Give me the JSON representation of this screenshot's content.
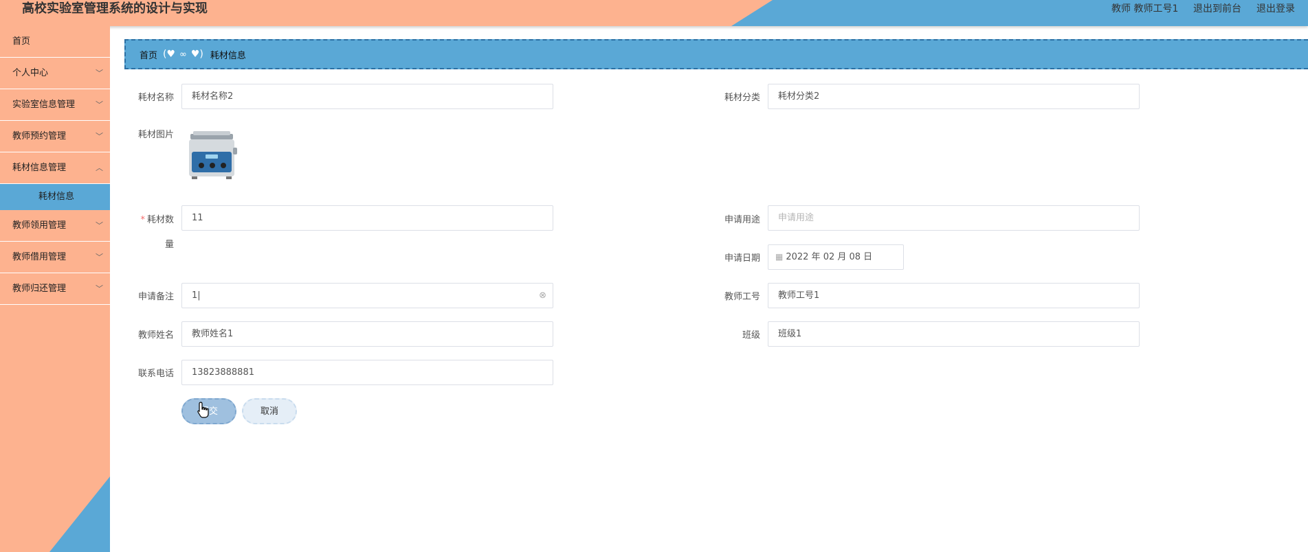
{
  "header": {
    "title": "高校实验室管理系统的设计与实现",
    "user_label": "教师  教师工号1",
    "to_front": "退出到前台",
    "logout": "退出登录"
  },
  "sidebar": {
    "items": [
      {
        "label": "首页"
      },
      {
        "label": "个人中心"
      },
      {
        "label": "实验室信息管理"
      },
      {
        "label": "教师预约管理"
      },
      {
        "label": "耗材信息管理"
      },
      {
        "label": "教师领用管理"
      },
      {
        "label": "教师借用管理"
      },
      {
        "label": "教师归还管理"
      }
    ],
    "sub_item": "耗材信息"
  },
  "breadcrumb": {
    "home": "首页",
    "current": "耗材信息"
  },
  "form": {
    "name_label": "耗材名称",
    "name_value": "耗材名称2",
    "category_label": "耗材分类",
    "category_value": "耗材分类2",
    "image_label": "耗材图片",
    "qty_label_a": "耗材数",
    "qty_label_b": "量",
    "qty_required": "*",
    "qty_value": "11",
    "purpose_label": "申请用途",
    "purpose_placeholder": "申请用途",
    "date_label": "申请日期",
    "date_value": "2022 年 02 月 08 日",
    "remark_label": "申请备注",
    "remark_value": "1|",
    "teacher_no_label": "教师工号",
    "teacher_no_value": "教师工号1",
    "teacher_name_label": "教师姓名",
    "teacher_name_value": "教师姓名1",
    "class_label": "班级",
    "class_value": "班级1",
    "phone_label": "联系电话",
    "phone_value": "13823888881",
    "submit": "提交",
    "cancel": "取消"
  },
  "colors": {
    "orange": "#fdb28f",
    "blue": "#5aa8d6"
  }
}
